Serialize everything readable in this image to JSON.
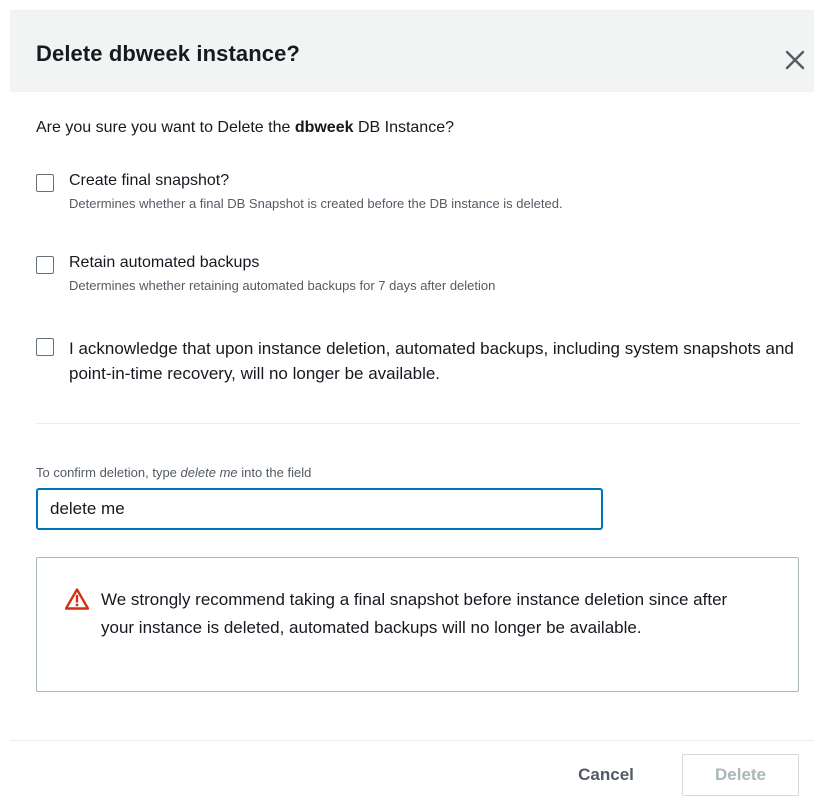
{
  "modal": {
    "title": "Delete dbweek instance?",
    "close_icon": "close-icon"
  },
  "prompt": {
    "prefix": "Are you sure you want to Delete the ",
    "instance_name": "dbweek",
    "suffix": " DB Instance?"
  },
  "options": [
    {
      "label": "Create final snapshot?",
      "description": "Determines whether a final DB Snapshot is created before the DB instance is deleted.",
      "checked": false
    },
    {
      "label": "Retain automated backups",
      "description": "Determines whether retaining automated backups for 7 days after deletion",
      "checked": false
    },
    {
      "label": "I acknowledge that upon instance deletion, automated backups, including system snapshots and point-in-time recovery, will no longer be available.",
      "checked": false
    }
  ],
  "confirm": {
    "label_prefix": "To confirm deletion, type ",
    "label_keyword": "delete me",
    "label_suffix": " into the field",
    "value": "delete me"
  },
  "alert": {
    "icon": "warning-icon",
    "color": "#d13212",
    "text": "We strongly recommend taking a final snapshot before instance deletion since after your instance is deleted, automated backups will no longer be available."
  },
  "footer": {
    "cancel_label": "Cancel",
    "delete_label": "Delete",
    "delete_disabled": true
  },
  "colors": {
    "header_bg": "#f2f3f3",
    "input_focus": "#0073bb",
    "secondary_text": "#545b64"
  }
}
